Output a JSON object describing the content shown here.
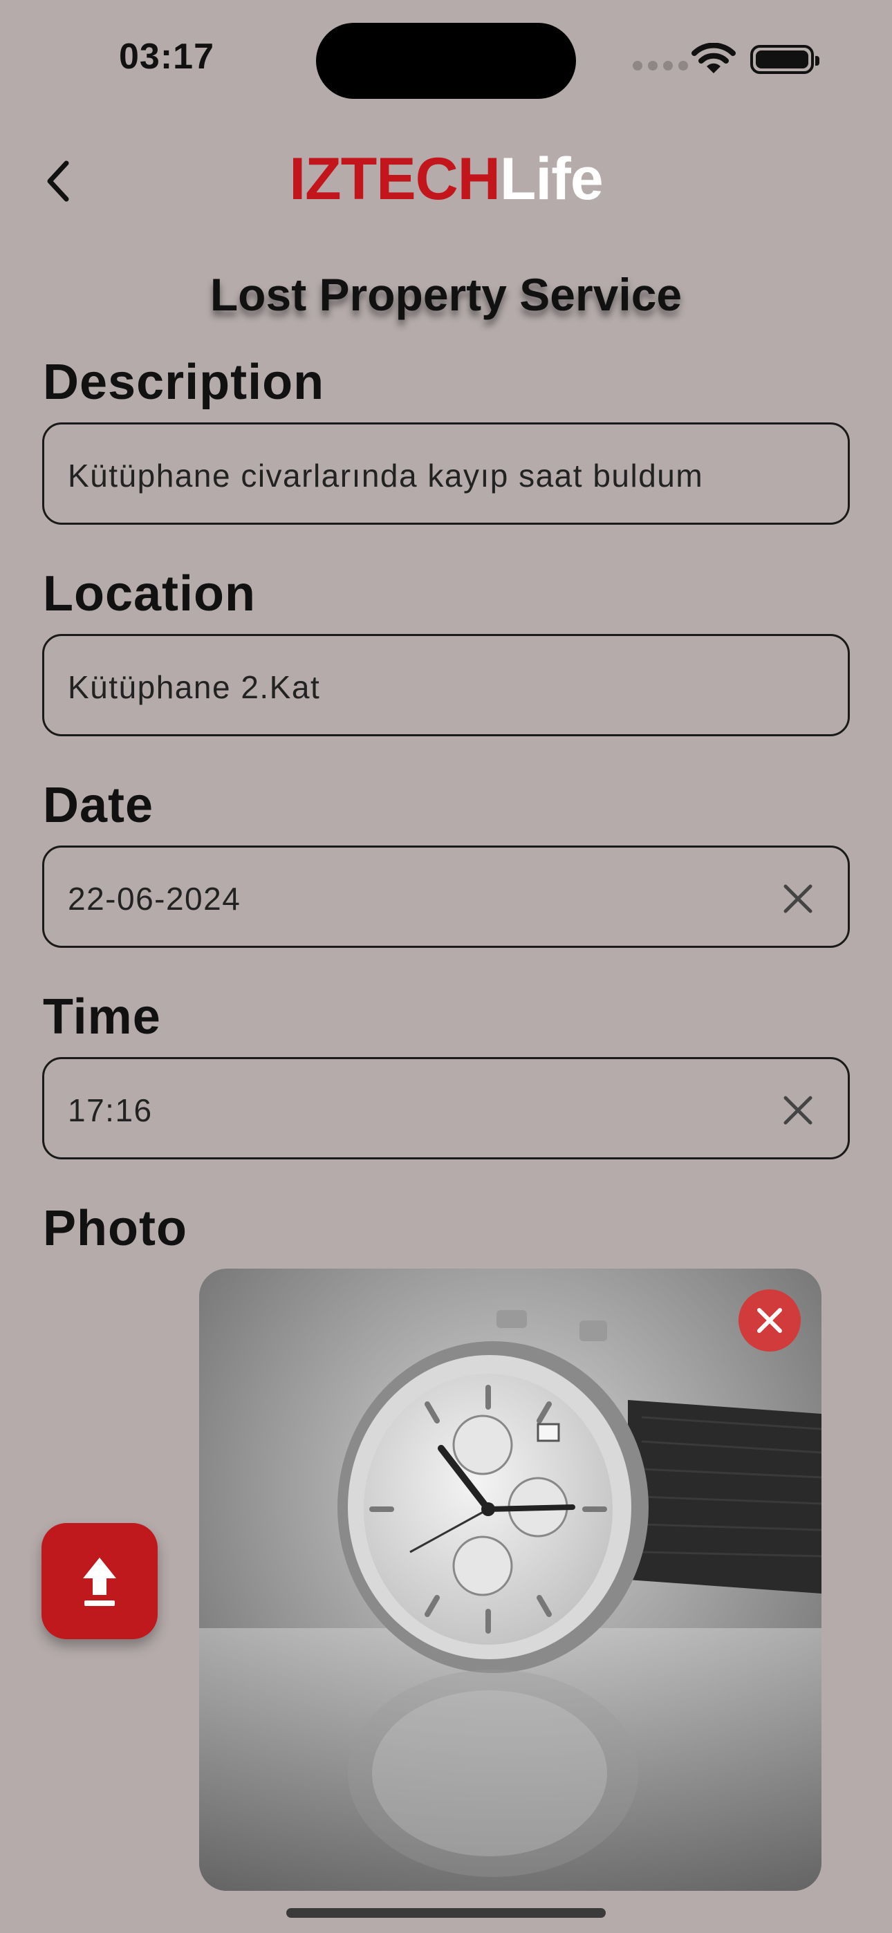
{
  "status_bar": {
    "time": "03:17"
  },
  "header": {
    "logo_part1": "IZTECH",
    "logo_part2": "Life"
  },
  "page": {
    "title": "Lost Property Service"
  },
  "form": {
    "description": {
      "label": "Description",
      "value": "Kütüphane civarlarında kayıp saat buldum"
    },
    "location": {
      "label": "Location",
      "value": "Kütüphane 2.Kat"
    },
    "date": {
      "label": "Date",
      "value": "22-06-2024"
    },
    "time": {
      "label": "Time",
      "value": "17:16"
    },
    "photo": {
      "label": "Photo"
    }
  },
  "icons": {
    "back": "chevron-left-icon",
    "clear": "close-icon",
    "upload": "upload-icon",
    "remove_photo": "close-icon"
  },
  "colors": {
    "background": "#b5abab",
    "brand_red": "#c3161c",
    "upload_button": "#c0191d",
    "remove_button": "#d13b3b"
  }
}
